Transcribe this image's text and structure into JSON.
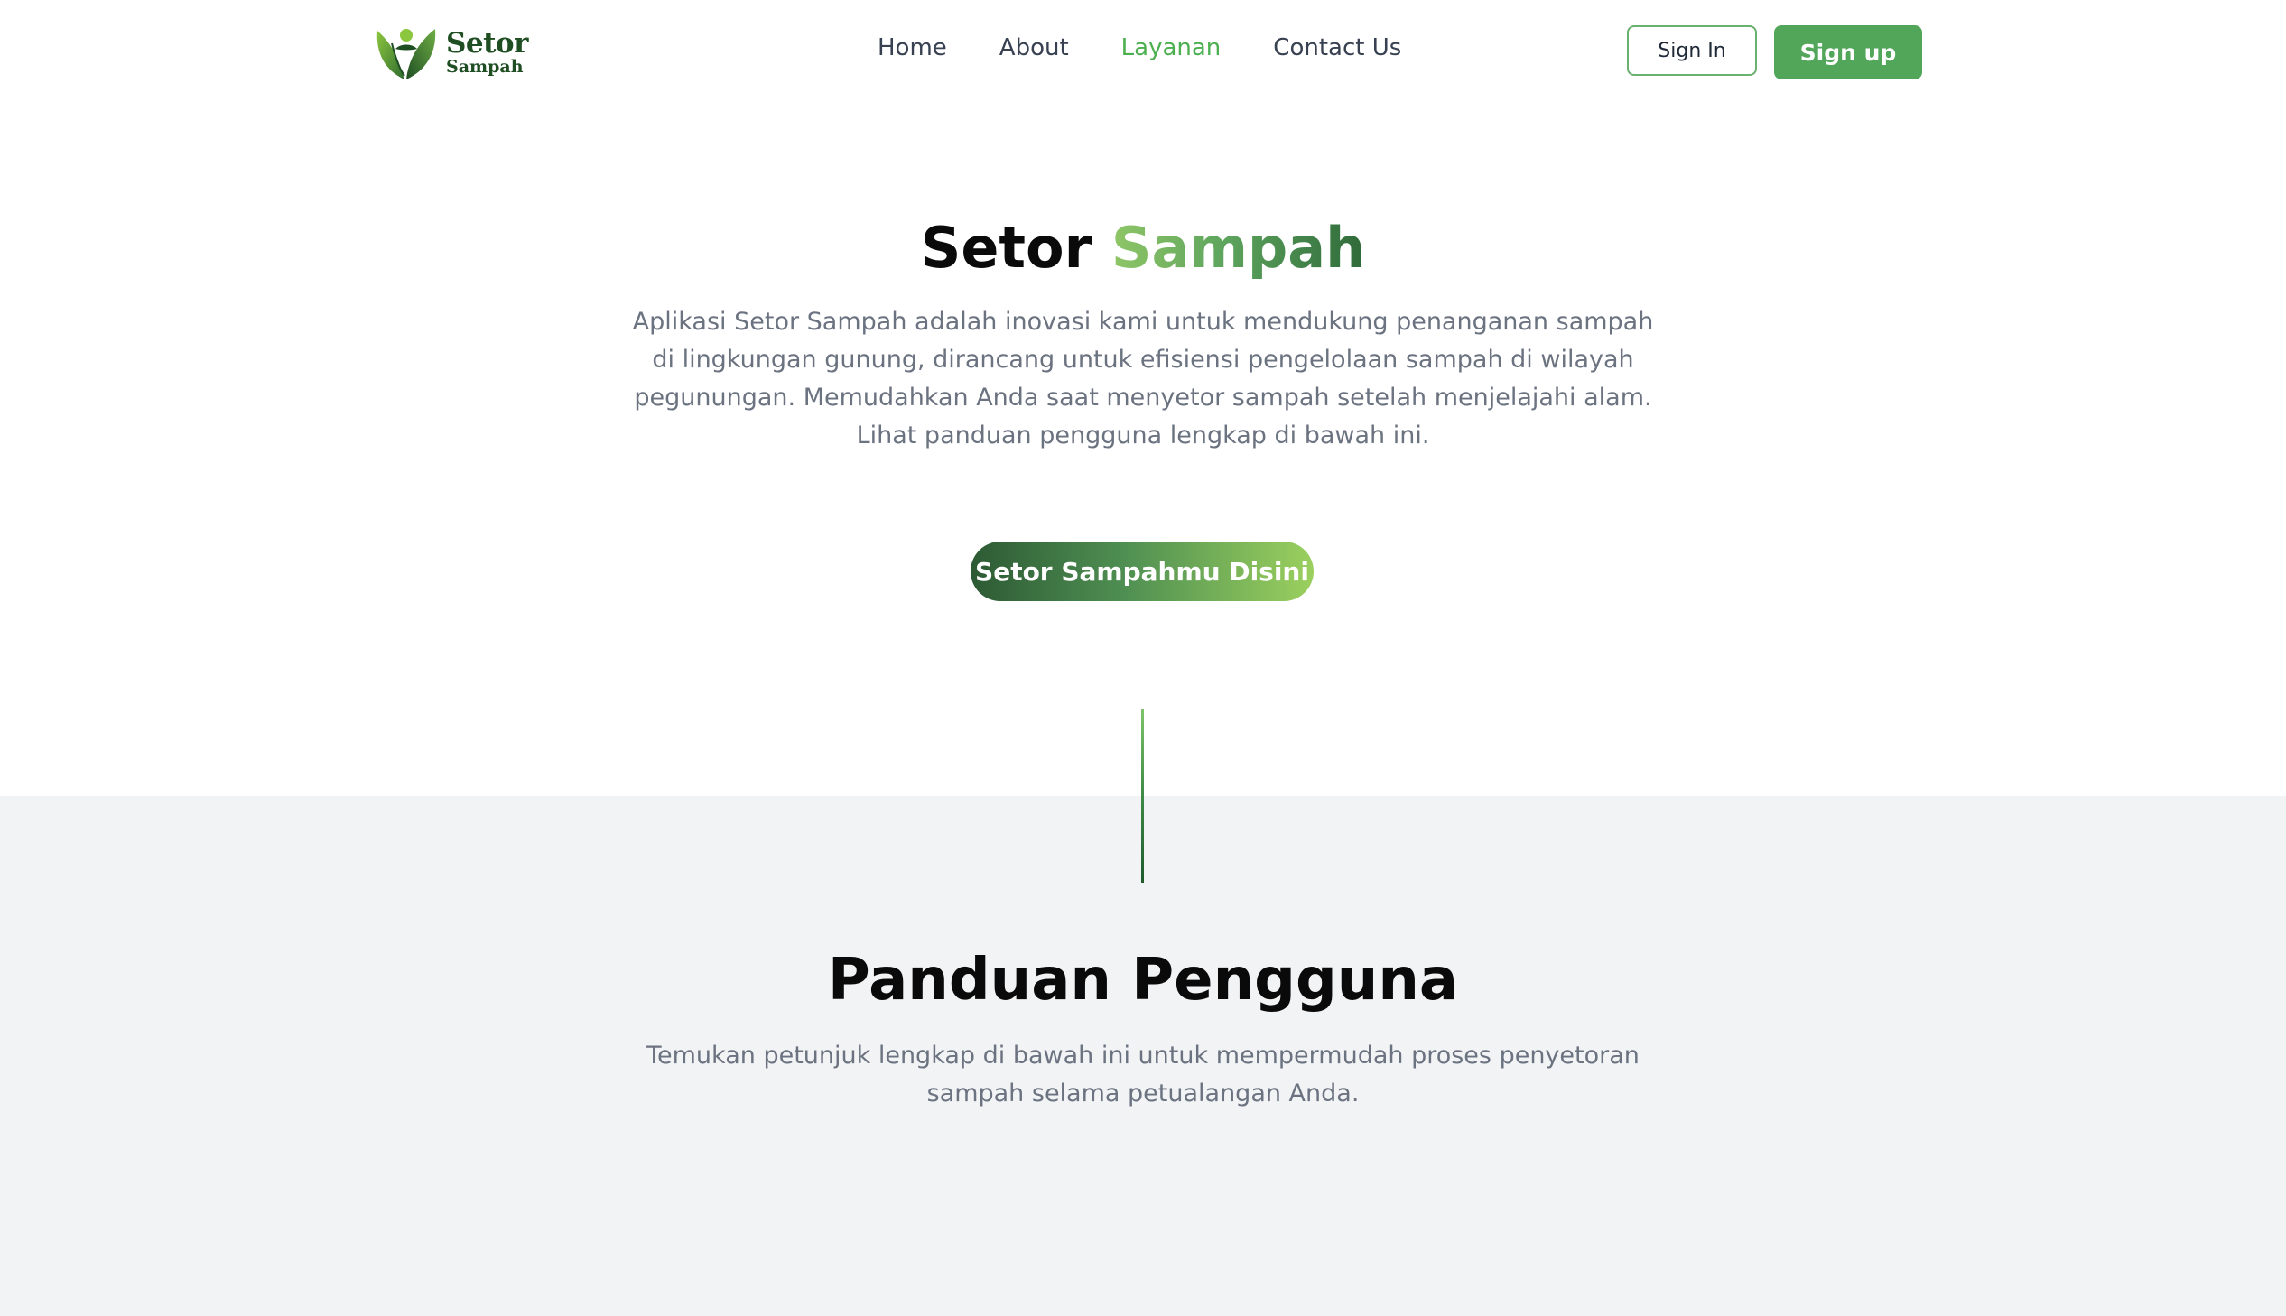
{
  "brand": {
    "name_line1": "Setor",
    "name_line2": "Sampah",
    "logo_icon": "leaf-person-icon",
    "color": "#1f4e23"
  },
  "nav": {
    "items": [
      {
        "label": "Home",
        "active": false
      },
      {
        "label": "About",
        "active": false
      },
      {
        "label": "Layanan",
        "active": true
      },
      {
        "label": "Contact Us",
        "active": false
      }
    ],
    "signin_label": "Sign In",
    "signup_label": "Sign up"
  },
  "hero": {
    "title_part1": "Setor",
    "title_part2": "Sampah",
    "description": "Aplikasi Setor Sampah adalah inovasi kami untuk mendukung penanganan sampah di lingkungan gunung, dirancang untuk efisiensi pengelolaan sampah di wilayah pegunungan. Memudahkan Anda saat menyetor sampah setelah menjelajahi alam. Lihat panduan pengguna lengkap di bawah ini.",
    "cta_label": "Setor Sampahmu Disini"
  },
  "guide": {
    "title": "Panduan Pengguna",
    "description": "Temukan petunjuk lengkap di bawah ini untuk mempermudah proses penyetoran sampah selama petualangan Anda."
  },
  "colors": {
    "accent": "#52a65a",
    "active_nav": "#4caf50",
    "section_bg": "#f2f3f5",
    "text_muted": "#6b7280"
  }
}
